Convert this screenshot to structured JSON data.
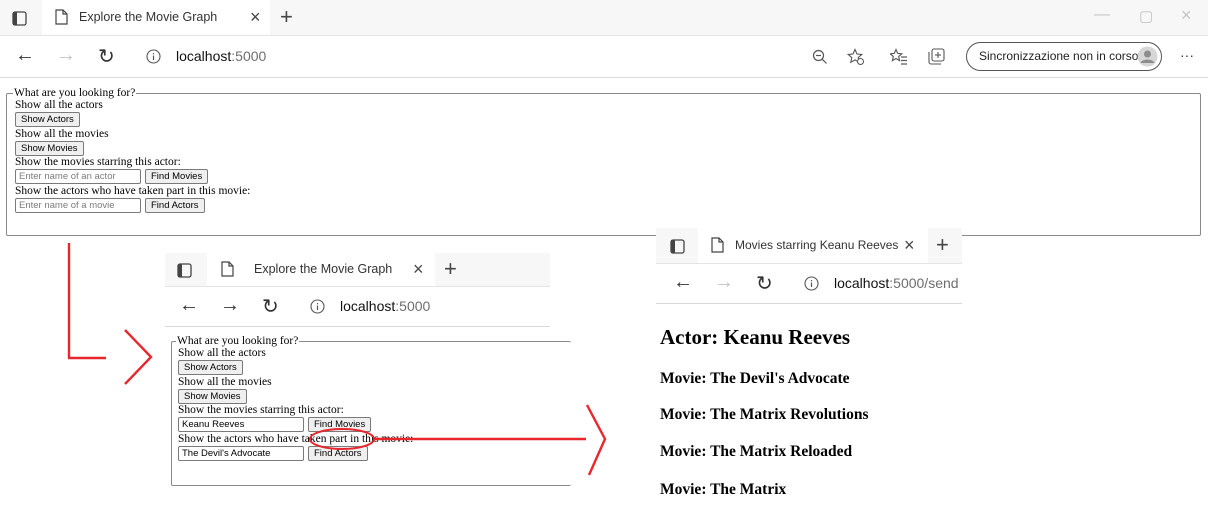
{
  "main_window": {
    "tab_title": "Explore the Movie Graph",
    "url_host": "localhost",
    "url_rest": ":5000",
    "sync_label": "Sincronizzazione non in corso",
    "more_label": "···"
  },
  "form": {
    "legend": "What are you looking for?",
    "show_actors_text": "Show all the actors",
    "show_actors_button": "Show Actors",
    "show_movies_text": "Show all the movies",
    "show_movies_button": "Show Movies",
    "actor_query_text": "Show the movies starring this actor:",
    "actor_placeholder": "Enter name of an actor",
    "find_movies_button": "Find Movies",
    "movie_query_text": "Show the actors who have taken part in this movie:",
    "movie_placeholder": "Enter name of a movie",
    "find_actors_button": "Find Actors"
  },
  "zoom_window": {
    "tab_title": "Explore the Movie Graph",
    "url_host": "localhost",
    "url_rest": ":5000",
    "actor_value": "Keanu Reeves",
    "movie_value": "The Devil's Advocate"
  },
  "result_window": {
    "tab_title": "Movies starring Keanu Reeves",
    "url_host": "localhost",
    "url_rest": ":5000/send",
    "actor_heading": "Actor: Keanu Reeves",
    "movies": [
      "Movie: The Devil's Advocate",
      "Movie: The Matrix Revolutions",
      "Movie: The Matrix Reloaded",
      "Movie: The Matrix"
    ]
  },
  "colors": {
    "annotation_red": "#e8272c"
  }
}
